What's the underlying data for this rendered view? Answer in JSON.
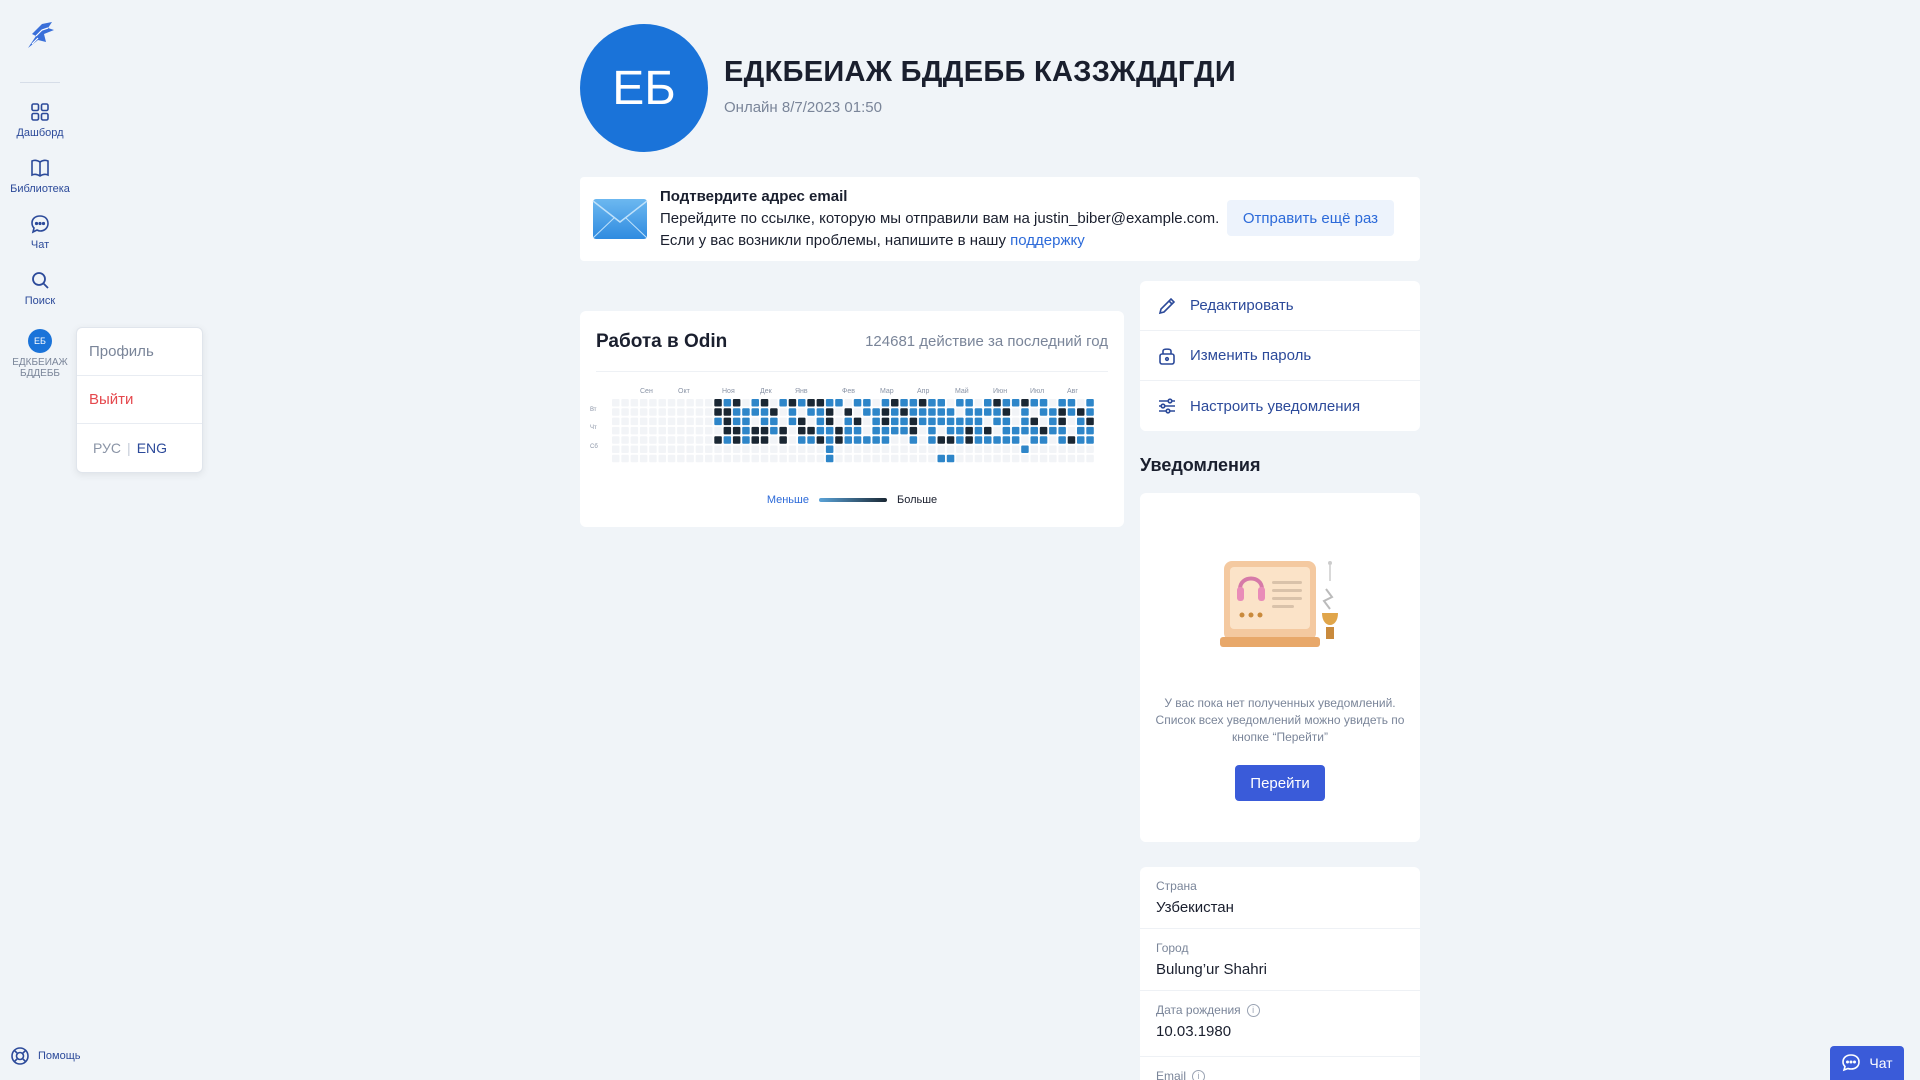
{
  "sidebar": {
    "items": [
      {
        "label": "Дашборд",
        "icon": "grid-icon"
      },
      {
        "label": "Библиотека",
        "icon": "book-icon"
      },
      {
        "label": "Чат",
        "icon": "chat-icon"
      },
      {
        "label": "Поиск",
        "icon": "search-icon"
      }
    ],
    "user_initials": "ЕБ",
    "user_name": "ЕДКБЕИАЖ БДДЕББ",
    "help_label": "Помощь"
  },
  "user_menu": {
    "profile": "Профиль",
    "logout": "Выйти",
    "lang_ru": "РУС",
    "lang_sep": "|",
    "lang_en": "ENG"
  },
  "profile": {
    "initials": "ЕБ",
    "name": "ЕДКБЕИАЖ БДДЕББ КАЗЗЖДДГДИ",
    "status": "Онлайн 8/7/2023 01:50"
  },
  "banner": {
    "title": "Подтвердите адрес email",
    "line1": "Перейдите по ссылке, которую мы отправили вам на justin_biber@example.com.",
    "line2_prefix": "Если у вас возникли проблемы, напишите в нашу ",
    "line2_link": "поддержку",
    "resend": "Отправить ещё раз"
  },
  "activity": {
    "title": "Работа в Odin",
    "count": "124681 действие за последний год",
    "months": [
      "Сен",
      "Окт",
      "Ноя",
      "Дек",
      "Янв",
      "Фев",
      "Мар",
      "Апр",
      "Май",
      "Июн",
      "Июл",
      "Авг"
    ],
    "days": [
      "Вт",
      "Чт",
      "Сб"
    ],
    "legend_less": "Меньше",
    "legend_more": "Больше",
    "colors": {
      "empty": "#f2f4f7",
      "mid": "#2e86c9",
      "high": "#1a2733"
    }
  },
  "actions": [
    {
      "label": "Редактировать",
      "icon": "pencil-icon"
    },
    {
      "label": "Изменить пароль",
      "icon": "lock-icon"
    },
    {
      "label": "Настроить уведомления",
      "icon": "sliders-icon"
    }
  ],
  "notifications": {
    "heading": "Уведомления",
    "empty_text": "У вас пока нет полученных уведомлений. Список всех уведомлений можно увидеть по кнопке “Перейти”",
    "go_button": "Перейти"
  },
  "info": [
    {
      "label": "Страна",
      "value": "Узбекистан"
    },
    {
      "label": "Город",
      "value": "Bulung’ur Shahri"
    },
    {
      "label": "Дата рождения",
      "value": "10.03.1980",
      "info": true
    },
    {
      "label": "Email",
      "value": "",
      "info": true
    }
  ],
  "chat_button": "Чат"
}
